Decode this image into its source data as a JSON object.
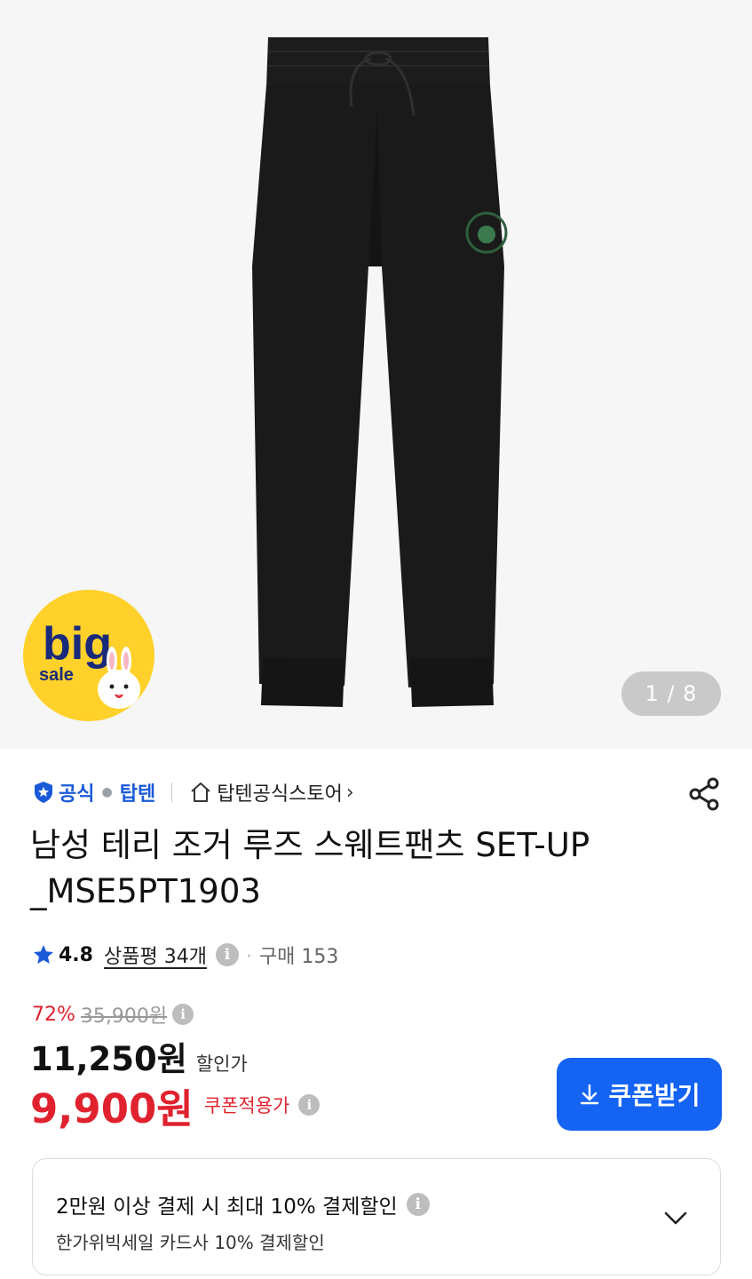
{
  "gallery": {
    "page_indicator": "1 / 8"
  },
  "sale_badge": {
    "big": "big",
    "sale": "sale"
  },
  "store": {
    "official_label": "공식",
    "brand": "탑텐",
    "store_name": "탑텐공식스토어",
    "chevron": "›"
  },
  "product": {
    "title": "남성 테리 조거 루즈 스웨트팬츠 SET-UP _MSE5PT1903"
  },
  "rating": {
    "score": "4.8",
    "reviews": "상품평 34개",
    "info": "i",
    "sold_dot": "·",
    "sold": "구매 153"
  },
  "pricing": {
    "discount_pct": "72%",
    "original_price": "35,900원",
    "sale_price": "11,250원",
    "sale_label": "할인가",
    "coupon_price": "9,900원",
    "coupon_label": "쿠폰적용가",
    "coupon_button": "쿠폰받기"
  },
  "payment_offer": {
    "title": "2만원 이상 결제 시 최대 10% 결제할인",
    "subtitle": "한가위빅세일 카드사 10% 결제할인"
  },
  "colors": {
    "accent_blue": "#1463f3",
    "sale_red": "#e0222f",
    "official_blue": "#1a5ad8"
  }
}
